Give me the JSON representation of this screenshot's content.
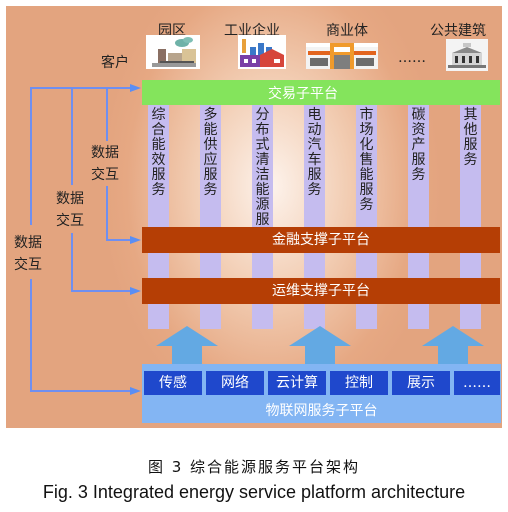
{
  "customers": {
    "label": "客户",
    "items": [
      {
        "label": "园区",
        "icon": "industrial-park-icon"
      },
      {
        "label": "工业企业",
        "icon": "factory-icon"
      },
      {
        "label": "商业体",
        "icon": "shopping-mall-icon"
      },
      {
        "label": "……",
        "icon": null
      },
      {
        "label": "公共建筑",
        "icon": "public-building-icon"
      }
    ]
  },
  "trading_platform": "交易子平台",
  "services": [
    "综合能效服务",
    "多能供应服务",
    "分布式清洁能源服务",
    "电动汽车服务",
    "市场化售能服务",
    "碳资产服务",
    "其他服务"
  ],
  "finance_platform": "金融支撑子平台",
  "ops_platform": "运维支撑子平台",
  "iot_platform": {
    "title": "物联网服务子平台",
    "modules": [
      "传感",
      "网络",
      "云计算",
      "控制",
      "展示",
      "……"
    ]
  },
  "data_exchange_label": [
    "数据",
    "交互"
  ],
  "colors": {
    "trading": "#84e45c",
    "service_column": "#c5bcef",
    "support_platform": "#b53e05",
    "iot_platform": "#83b5f3",
    "iot_module": "#1f48cc",
    "connector": "#6f8ff0",
    "up_arrow": "#63a9e3"
  },
  "caption": {
    "cn": "图 3  综合能源服务平台架构",
    "en": "Fig. 3    Integrated energy service platform architecture"
  }
}
